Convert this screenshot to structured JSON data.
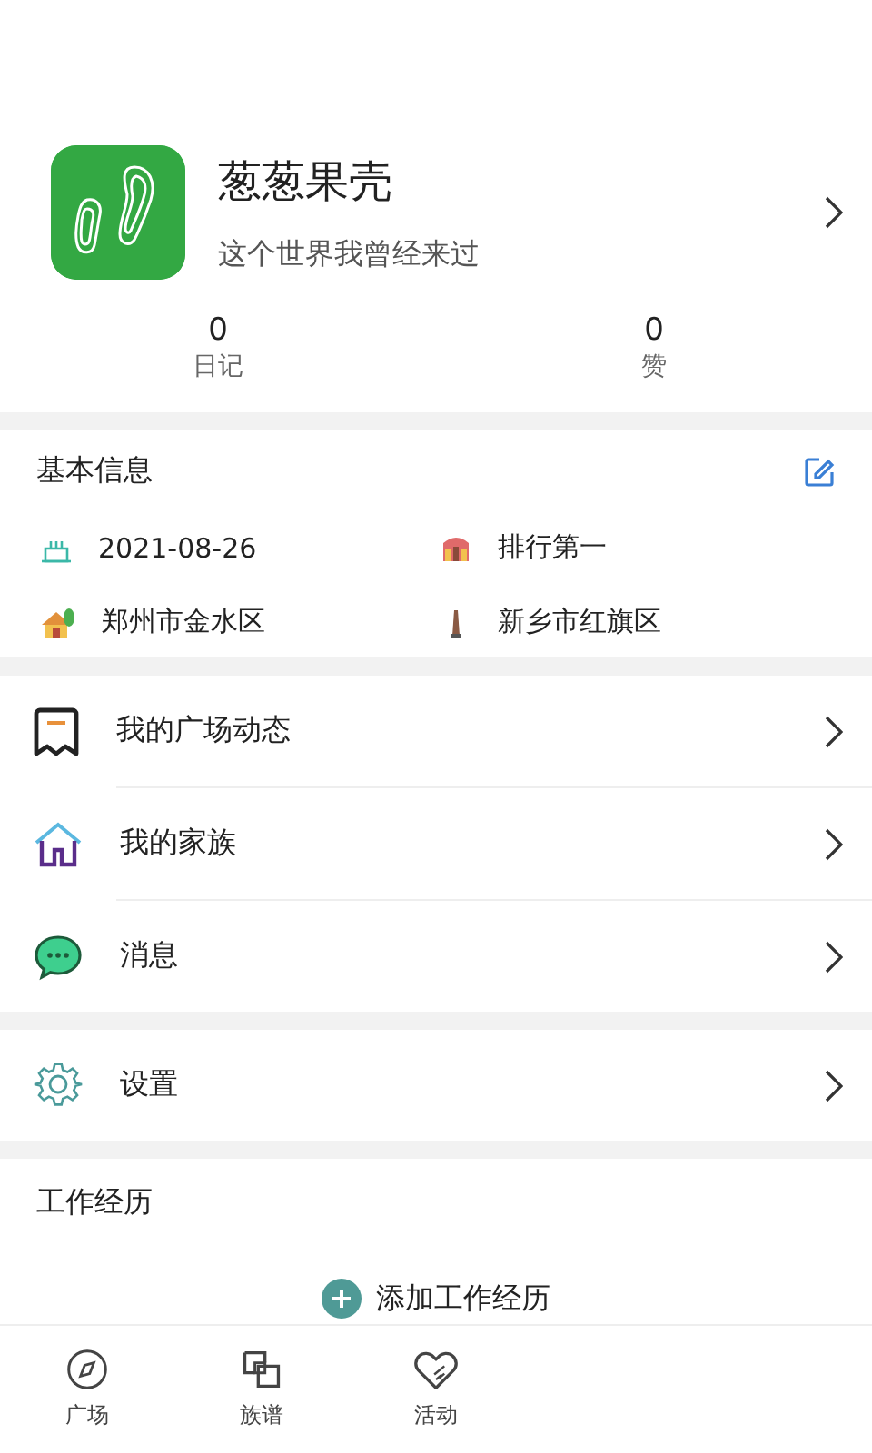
{
  "profile": {
    "name": "葱葱果壳",
    "motto": "这个世界我曾经来过"
  },
  "stats": [
    {
      "value": "0",
      "label": "日记"
    },
    {
      "value": "0",
      "label": "赞"
    }
  ],
  "basic_info": {
    "title": "基本信息",
    "items": [
      {
        "kind": "birthday",
        "text": "2021-08-26"
      },
      {
        "kind": "rank",
        "text": "排行第一"
      },
      {
        "kind": "home",
        "text": "郑州市金水区"
      },
      {
        "kind": "tower",
        "text": "新乡市红旗区"
      }
    ]
  },
  "menu": [
    {
      "kind": "posts",
      "label": "我的广场动态"
    },
    {
      "kind": "family",
      "label": "我的家族"
    },
    {
      "kind": "message",
      "label": "消息"
    }
  ],
  "settings": {
    "label": "设置"
  },
  "work": {
    "title": "工作经历",
    "add_label": "添加工作经历"
  },
  "bottom_nav": [
    {
      "kind": "compass",
      "label": "广场"
    },
    {
      "kind": "tree",
      "label": "族谱"
    },
    {
      "kind": "heart",
      "label": "活动"
    }
  ]
}
